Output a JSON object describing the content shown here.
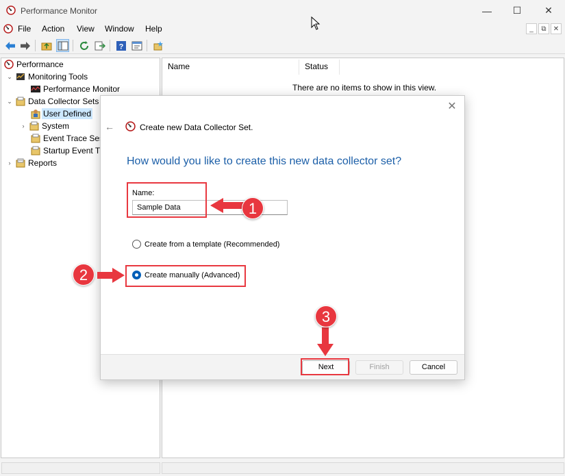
{
  "window": {
    "title": "Performance Monitor",
    "controls": {
      "minimize": "—",
      "maximize": "☐",
      "close": "✕"
    }
  },
  "menubar": {
    "items": [
      "File",
      "Action",
      "View",
      "Window",
      "Help"
    ],
    "mdi_controls": [
      "_",
      "⧉",
      "✕"
    ]
  },
  "toolbar": {
    "icons": [
      "back-arrow-icon",
      "forward-arrow-icon",
      "folder-up-icon",
      "show-hide-console-tree-icon",
      "refresh-icon",
      "export-list-icon",
      "help-icon",
      "properties-icon",
      "new-collector-icon"
    ]
  },
  "tree": {
    "items": [
      {
        "label": "Performance",
        "level": 0,
        "expander": ""
      },
      {
        "label": "Monitoring Tools",
        "level": 1,
        "expander": "⌄"
      },
      {
        "label": "Performance Monitor",
        "level": 2,
        "expander": ""
      },
      {
        "label": "Data Collector Sets",
        "level": 1,
        "expander": "⌄"
      },
      {
        "label": "User Defined",
        "level": 2,
        "expander": "",
        "selected": true
      },
      {
        "label": "System",
        "level": 2,
        "expander": "›"
      },
      {
        "label": "Event Trace Sess",
        "level": 2,
        "expander": ""
      },
      {
        "label": "Startup Event Tr",
        "level": 2,
        "expander": ""
      },
      {
        "label": "Reports",
        "level": 1,
        "expander": "›"
      }
    ]
  },
  "list": {
    "columns": [
      "Name",
      "Status"
    ],
    "empty_message": "There are no items to show in this view."
  },
  "dialog": {
    "heading": "Create new Data Collector Set.",
    "question": "How would you like to create this new data collector set?",
    "name_label": "Name:",
    "name_value": "Sample Data",
    "options": [
      {
        "label": "Create from a template (Recommended)",
        "checked": false
      },
      {
        "label": "Create manually (Advanced)",
        "checked": true
      }
    ],
    "buttons": {
      "next": "Next",
      "finish": "Finish",
      "cancel": "Cancel"
    },
    "close_glyph": "✕",
    "back_glyph": "←"
  },
  "annotations": {
    "steps": [
      "1",
      "2",
      "3"
    ],
    "color": "#e8373f"
  }
}
